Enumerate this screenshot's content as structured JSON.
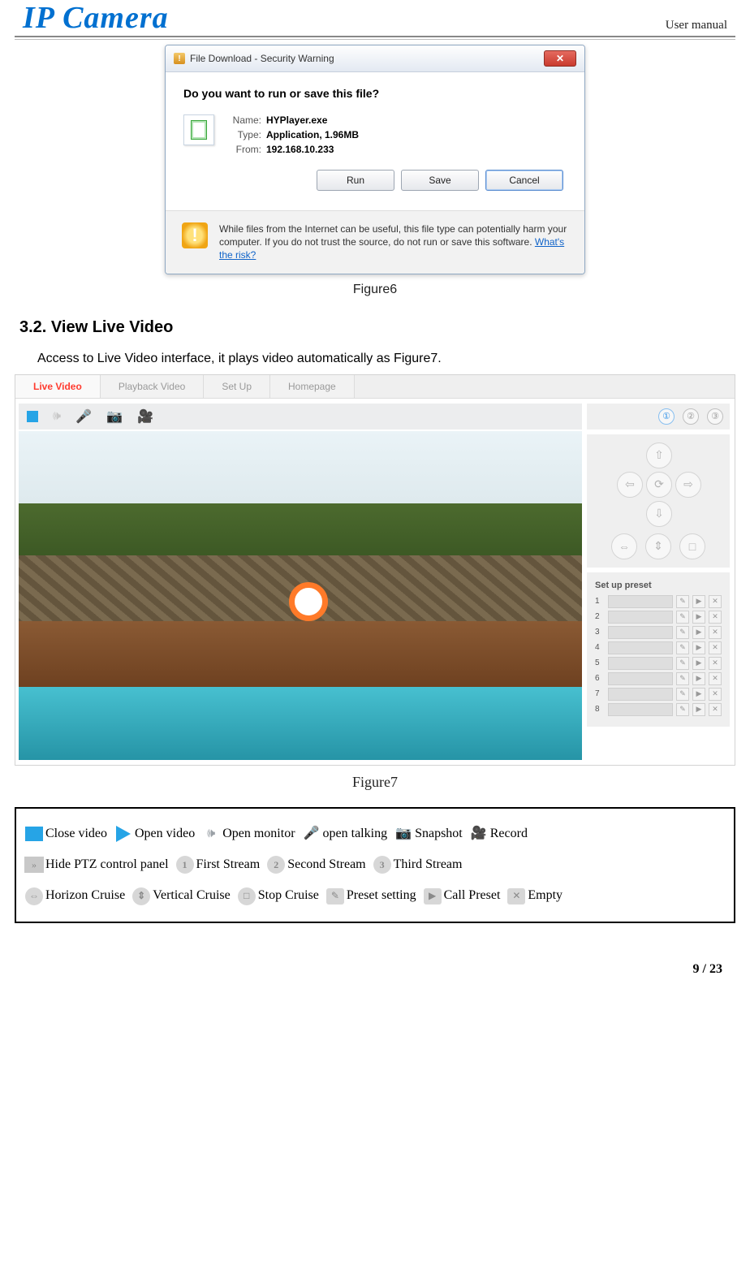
{
  "header": {
    "logo": "IP Camera",
    "right": "User manual"
  },
  "dialog": {
    "title": "File Download - Security Warning",
    "question": "Do you want to run or save this file?",
    "name_label": "Name:",
    "name_value": "HYPlayer.exe",
    "type_label": "Type:",
    "type_value": "Application, 1.96MB",
    "from_label": "From:",
    "from_value": "192.168.10.233",
    "run": "Run",
    "save": "Save",
    "cancel": "Cancel",
    "warning": "While files from the Internet can be useful, this file type can potentially harm your computer. If you do not trust the source, do not run or save this software. ",
    "warning_link": "What's the risk?"
  },
  "figure6_caption": "Figure6",
  "section_heading": "3.2. View Live Video",
  "intro": "Access to Live Video interface, it plays video automatically as Figure7.",
  "fig7": {
    "tabs": {
      "live": "Live Video",
      "playback": "Playback Video",
      "setup": "Set Up",
      "home": "Homepage"
    },
    "streams": {
      "s1": "①",
      "s2": "②",
      "s3": "③"
    },
    "preset_title": "Set up preset",
    "preset_rows": [
      "1",
      "2",
      "3",
      "4",
      "5",
      "6",
      "7",
      "8"
    ]
  },
  "figure7_caption": "Figure7",
  "legend": {
    "close_video": "Close video",
    "open_video": "Open video",
    "open_monitor": "Open monitor",
    "open_talking": "open talking",
    "snapshot": "Snapshot",
    "record": "Record",
    "hide_ptz": "Hide PTZ control panel",
    "first_stream": "First Stream",
    "second_stream": "Second Stream",
    "third_stream": "Third Stream",
    "horizon_cruise": "Horizon Cruise",
    "vertical_cruise": "Vertical Cruise",
    "stop_cruise": "Stop Cruise",
    "preset_setting": "Preset setting",
    "call_preset": "Call Preset",
    "empty": "Empty"
  },
  "footer": "9 / 23"
}
